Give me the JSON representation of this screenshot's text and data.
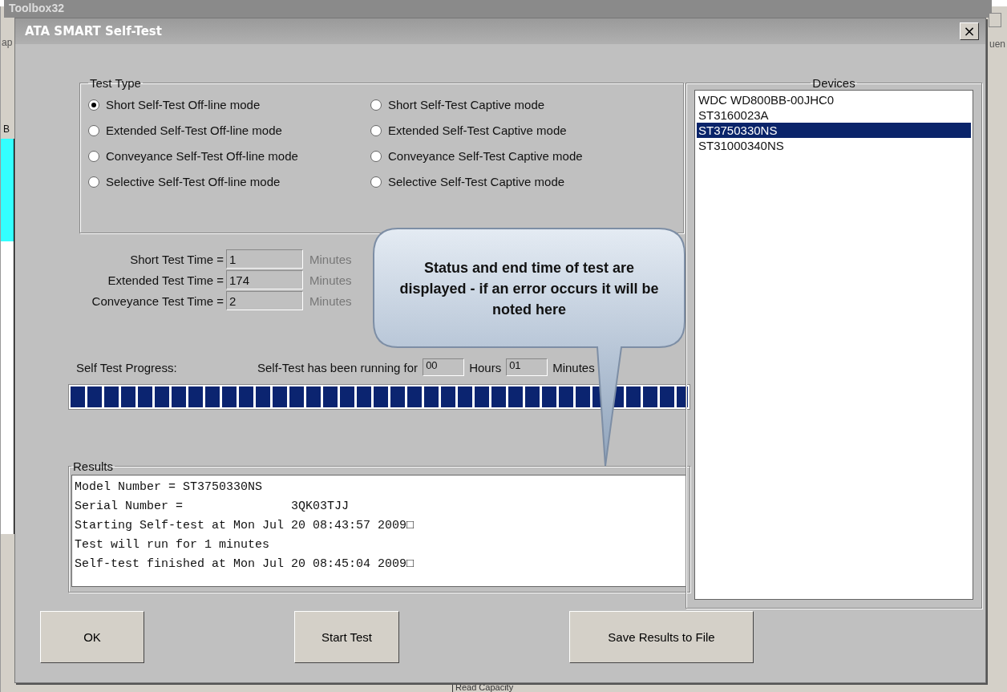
{
  "background_window": {
    "title": "Toolbox32",
    "left_fragment": "ap",
    "tab_fragment": "B",
    "right_fragment": "uen",
    "bottom_fragment": "Read Capacity"
  },
  "dialog": {
    "title": "ATA SMART Self-Test",
    "close": "×"
  },
  "test_type": {
    "legend": "Test Type",
    "options": [
      {
        "label": "Short Self-Test  Off-line mode",
        "selected": true
      },
      {
        "label": "Short Self-Test  Captive mode",
        "selected": false
      },
      {
        "label": "Extended Self-Test  Off-line mode",
        "selected": false
      },
      {
        "label": "Extended Self-Test  Captive mode",
        "selected": false
      },
      {
        "label": "Conveyance Self-Test  Off-line mode",
        "selected": false
      },
      {
        "label": "Conveyance Self-Test  Captive mode",
        "selected": false
      },
      {
        "label": "Selective Self-Test  Off-line mode",
        "selected": false
      },
      {
        "label": "Selective Self-Test  Captive mode",
        "selected": false
      }
    ]
  },
  "test_times": [
    {
      "label": "Short Test Time =",
      "value": "1",
      "unit": "Minutes"
    },
    {
      "label": "Extended Test Time =",
      "value": "174",
      "unit": "Minutes"
    },
    {
      "label": "Conveyance Test Time =",
      "value": "2",
      "unit": "Minutes"
    }
  ],
  "progress": {
    "label": "Self Test Progress:",
    "running_text": "Self-Test has been running for",
    "hours": "00",
    "hours_label": "Hours",
    "minutes": "01",
    "minutes_label": "Minutes",
    "level": 1
  },
  "results": {
    "legend": "Results",
    "lines": [
      "Model Number = ST3750330NS",
      "Serial Number =               3QK03TJJ",
      "Starting Self-test at Mon Jul 20 08:43:57 2009□",
      "Test will run for 1 minutes",
      "Self-test finished at Mon Jul 20 08:45:04 2009□"
    ]
  },
  "devices": {
    "legend": "Devices",
    "items": [
      {
        "label": "WDC WD800BB-00JHC0",
        "selected": false
      },
      {
        "label": "ST3160023A",
        "selected": false
      },
      {
        "label": "ST3750330NS",
        "selected": true
      },
      {
        "label": "ST31000340NS",
        "selected": false
      }
    ]
  },
  "buttons": [
    "OK",
    "Start Test",
    "Save Results to File"
  ],
  "callout": {
    "text": "Status and end time of test are displayed - if an error occurs it will be noted here"
  }
}
